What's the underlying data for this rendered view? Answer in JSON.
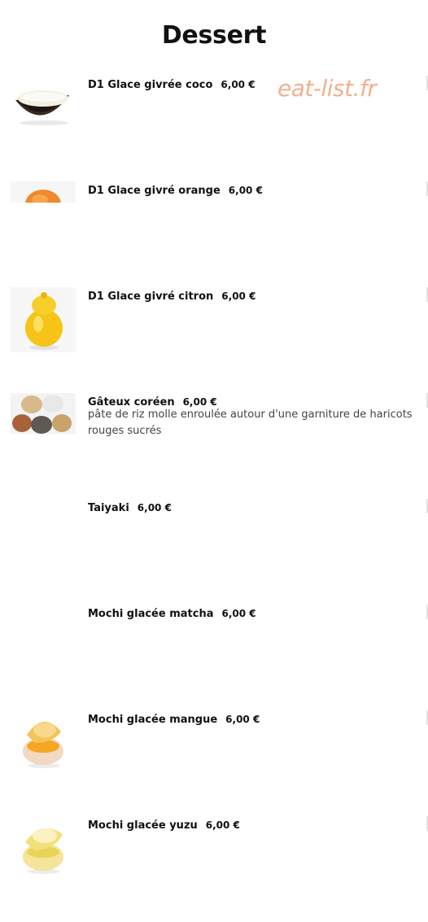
{
  "page": {
    "title": "Dessert",
    "watermark": "eat-list.fr"
  },
  "items": [
    {
      "name": "D1 Glace givrée coco",
      "price": "6,00 €",
      "description": "",
      "image": "coconut-ice-cream-image"
    },
    {
      "name": "D1 Glace givré orange",
      "price": "6,00 €",
      "description": "",
      "image": "orange-ice-cream-image"
    },
    {
      "name": "D1 Glace givré citron",
      "price": "6,00 €",
      "description": "",
      "image": "lemon-ice-cream-image"
    },
    {
      "name": "Gâteux coréen",
      "price": "6,00 €",
      "description": "pâte de riz molle enroulée autour d'une garniture de haricots rouges sucrés",
      "image": "korean-rice-cakes-image"
    },
    {
      "name": "Taiyaki",
      "price": "6,00 €",
      "description": "",
      "image": ""
    },
    {
      "name": "Mochi glacée matcha",
      "price": "6,00 €",
      "description": "",
      "image": ""
    },
    {
      "name": "Mochi glacée mangue",
      "price": "6,00 €",
      "description": "",
      "image": "mango-mochi-image"
    },
    {
      "name": "Mochi glacée yuzu",
      "price": "6,00 €",
      "description": "",
      "image": "yuzu-mochi-image"
    }
  ]
}
